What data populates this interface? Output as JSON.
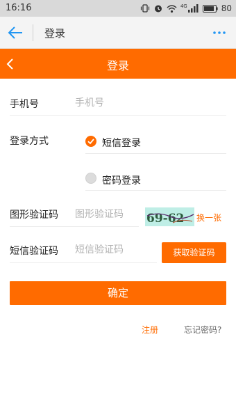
{
  "status_bar": {
    "time": "16:16",
    "network": "4G",
    "battery": "80",
    "icons": [
      "vibrate-icon",
      "alarm-icon",
      "wifi-icon",
      "signal-icon",
      "battery-icon"
    ]
  },
  "app_bar": {
    "title": "登录",
    "icons": [
      "back-arrow-icon",
      "more-icon"
    ]
  },
  "page_header": {
    "title": "登录"
  },
  "form": {
    "phone": {
      "label": "手机号",
      "placeholder": "手机号"
    },
    "login_method": {
      "label": "登录方式",
      "options": [
        {
          "label": "短信登录",
          "checked": true
        },
        {
          "label": "密码登录",
          "checked": false
        }
      ]
    },
    "image_captcha": {
      "label": "图形验证码",
      "placeholder": "图形验证码",
      "captcha_text": "69-62",
      "refresh_label": "换一张"
    },
    "sms_code": {
      "label": "短信验证码",
      "placeholder": "短信验证码",
      "button_label": "获取验证码"
    },
    "confirm_label": "确定"
  },
  "links": {
    "register": "注册",
    "forgot_password": "忘记密码?"
  },
  "colors": {
    "accent": "#ff6b00",
    "app_bar_icon": "#2196f3",
    "captcha_bg": "#bfeee6"
  }
}
